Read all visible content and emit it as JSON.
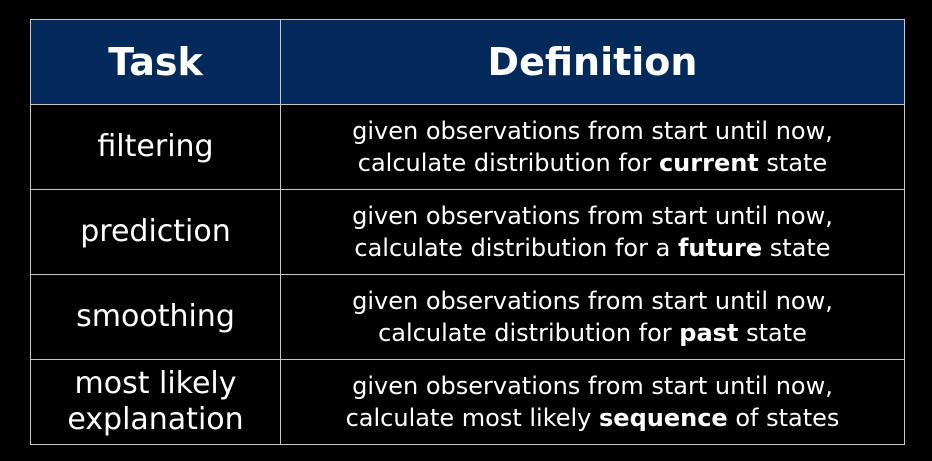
{
  "table": {
    "header": {
      "task": "Task",
      "definition": "Definition"
    },
    "rows": [
      {
        "task": "filtering",
        "line1": "given observations from start until now,",
        "line2_pre": "calculate distribution for ",
        "line2_bold": "current",
        "line2_post": " state"
      },
      {
        "task": "prediction",
        "line1": "given observations from start until now,",
        "line2_pre": "calculate distribution for a ",
        "line2_bold": "future",
        "line2_post": " state"
      },
      {
        "task": "smoothing",
        "line1": "given observations from start until now,",
        "line2_pre": "calculate distribution for ",
        "line2_bold": "past",
        "line2_post": " state"
      },
      {
        "task_line1": "most likely",
        "task_line2": "explanation",
        "line1": "given observations from start until now,",
        "line2_pre": "calculate most likely ",
        "line2_bold": "sequence",
        "line2_post": " of states"
      }
    ]
  },
  "colors": {
    "header_background": "#042a5c",
    "page_background": "#000000",
    "text": "#ffffff",
    "border": "#c8c8c8"
  }
}
